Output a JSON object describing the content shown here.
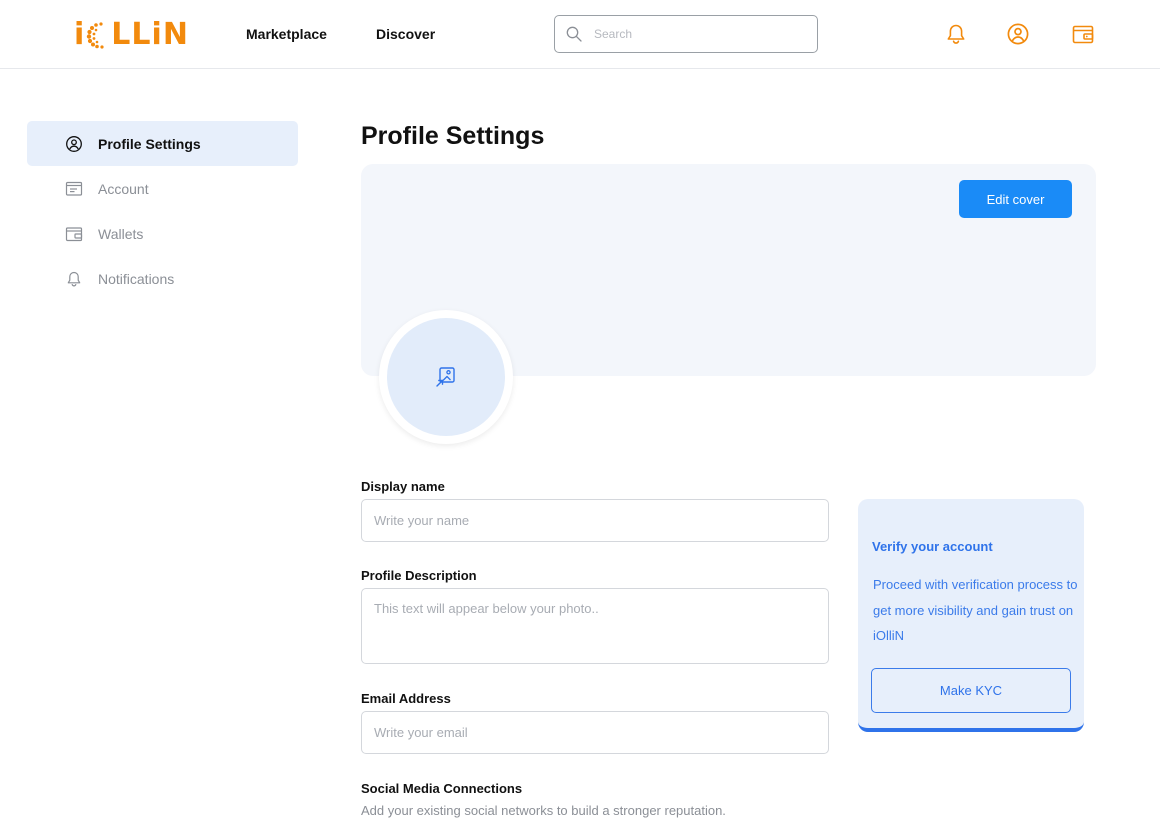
{
  "brand": {
    "logo_text_left": "i",
    "logo_text_right": "LLiN",
    "accent": "#f28a0d",
    "primary": "#1a8bf7"
  },
  "header": {
    "nav": [
      "Marketplace",
      "Discover"
    ],
    "search_placeholder": "Search",
    "icons": [
      "bell-icon",
      "user-circle-icon",
      "wallet-icon"
    ]
  },
  "sidebar": {
    "items": [
      {
        "label": "Profile Settings",
        "icon": "user-circle-icon",
        "active": true
      },
      {
        "label": "Account",
        "icon": "id-card-icon",
        "active": false
      },
      {
        "label": "Wallets",
        "icon": "wallet-icon",
        "active": false
      },
      {
        "label": "Notifications",
        "icon": "bell-icon",
        "active": false
      }
    ]
  },
  "main": {
    "title": "Profile Settings",
    "edit_cover_label": "Edit cover",
    "avatar_icon": "image-upload-icon",
    "fields": {
      "display_name": {
        "label": "Display name",
        "placeholder": "Write your name",
        "value": ""
      },
      "description": {
        "label": "Profile Description",
        "placeholder": "This text will appear below your photo..",
        "value": ""
      },
      "email": {
        "label": "Email Address",
        "placeholder": "Write your email",
        "value": ""
      }
    },
    "social": {
      "label": "Social Media Connections",
      "subtitle": "Add your existing social networks to build a stronger reputation."
    }
  },
  "verify": {
    "title": "Verify your account",
    "body": "Proceed with verification process to get more visibility and gain trust on iOlliN",
    "button_label": "Make KYC"
  }
}
